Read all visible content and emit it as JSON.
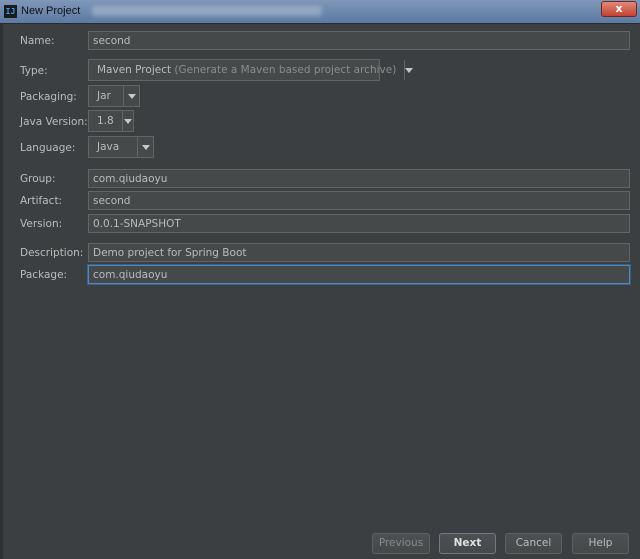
{
  "window": {
    "title": "New Project",
    "close_label": "x"
  },
  "form": {
    "name": {
      "label": "Name:",
      "value": "second"
    },
    "type": {
      "label": "Type:",
      "value": "Maven Project",
      "hint": " (Generate a Maven based project archive)"
    },
    "packaging": {
      "label": "Packaging:",
      "value": "Jar"
    },
    "java_version": {
      "label": "Java Version:",
      "value": "1.8"
    },
    "language": {
      "label": "Language:",
      "value": "Java"
    },
    "group": {
      "label": "Group:",
      "value": "com.qiudaoyu"
    },
    "artifact": {
      "label": "Artifact:",
      "value": "second"
    },
    "version": {
      "label": "Version:",
      "value": "0.0.1-SNAPSHOT"
    },
    "description": {
      "label": "Description:",
      "value": "Demo project for Spring Boot"
    },
    "package": {
      "label": "Package:",
      "value": "com.qiudaoyu"
    }
  },
  "buttons": {
    "previous": "Previous",
    "next": "Next",
    "cancel": "Cancel",
    "help": "Help"
  },
  "icons": {
    "app": "intellij-icon",
    "dropdown": "chevron-down-icon"
  }
}
